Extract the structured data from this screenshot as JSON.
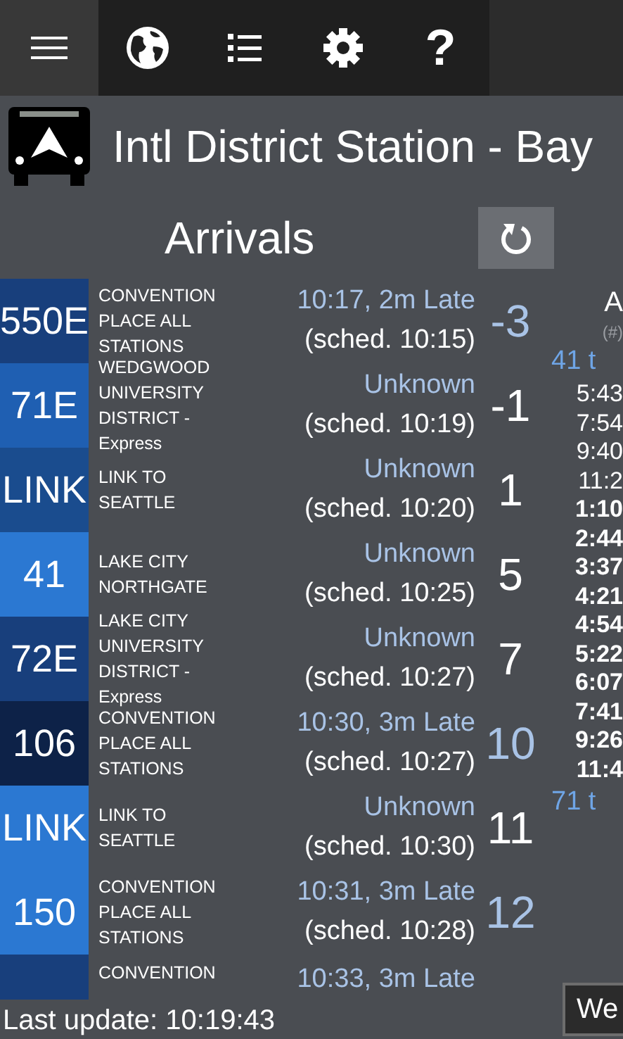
{
  "toolbar": {
    "help_label": "?"
  },
  "stop": {
    "title": "Intl District Station - Bay"
  },
  "section": {
    "title": "Arrivals"
  },
  "arrivals": [
    {
      "route": "550E",
      "color": "#183f7c",
      "destination": "CONVENTION PLACE ALL STATIONS",
      "status": "10:17, 2m Late",
      "scheduled": "(sched. 10:15)",
      "minutes": "-3",
      "predicted": true
    },
    {
      "route": "71E",
      "color": "#1f5fb2",
      "destination": "WEDGWOOD UNIVERSITY DISTRICT - Express",
      "status": "Unknown",
      "scheduled": "(sched. 10:19)",
      "minutes": "-1",
      "predicted": false
    },
    {
      "route": "LINK",
      "color": "#1a4c8e",
      "destination": "LINK TO SEATTLE",
      "status": "Unknown",
      "scheduled": "(sched. 10:20)",
      "minutes": "1",
      "predicted": false
    },
    {
      "route": "41",
      "color": "#2b78d2",
      "destination": "LAKE CITY NORTHGATE",
      "status": "Unknown",
      "scheduled": "(sched. 10:25)",
      "minutes": "5",
      "predicted": false
    },
    {
      "route": "72E",
      "color": "#183f7c",
      "destination": "LAKE CITY UNIVERSITY DISTRICT - Express",
      "status": "Unknown",
      "scheduled": "(sched. 10:27)",
      "minutes": "7",
      "predicted": false
    },
    {
      "route": "106",
      "color": "#0d2248",
      "destination": "CONVENTION PLACE ALL STATIONS",
      "status": "10:30, 3m Late",
      "scheduled": "(sched. 10:27)",
      "minutes": "10",
      "predicted": true
    },
    {
      "route": "LINK",
      "color": "#2b78d2",
      "destination": "LINK TO SEATTLE",
      "status": "Unknown",
      "scheduled": "(sched. 10:30)",
      "minutes": "11",
      "predicted": false
    },
    {
      "route": "150",
      "color": "#2b78d2",
      "destination": "CONVENTION PLACE ALL STATIONS",
      "status": "10:31, 3m Late",
      "scheduled": "(sched. 10:28)",
      "minutes": "12",
      "predicted": true
    },
    {
      "color": "#183f7c",
      "destination": "CONVENTION",
      "status": "10:33, 3m Late"
    }
  ],
  "schedule": {
    "title": "A",
    "subtitle": "(#)",
    "groups": [
      {
        "heading": "41 t",
        "times": [
          {
            "time": "5:43",
            "pm": false
          },
          {
            "time": "7:54",
            "pm": false
          },
          {
            "time": "9:40",
            "pm": false
          },
          {
            "time": "11:2",
            "pm": false
          },
          {
            "time": "1:10",
            "pm": true
          },
          {
            "time": "2:44",
            "pm": true
          },
          {
            "time": "3:37",
            "pm": true
          },
          {
            "time": "4:21",
            "pm": true
          },
          {
            "time": "4:54",
            "pm": true
          },
          {
            "time": "5:22",
            "pm": true
          },
          {
            "time": "6:07",
            "pm": true
          },
          {
            "time": "7:41",
            "pm": true
          },
          {
            "time": "9:26",
            "pm": true
          },
          {
            "time": "11:4",
            "pm": true
          }
        ]
      },
      {
        "heading": "71 t"
      }
    ]
  },
  "day_picker": {
    "value": "We"
  },
  "status_bar": {
    "text": "Last update: 10:19:43"
  }
}
